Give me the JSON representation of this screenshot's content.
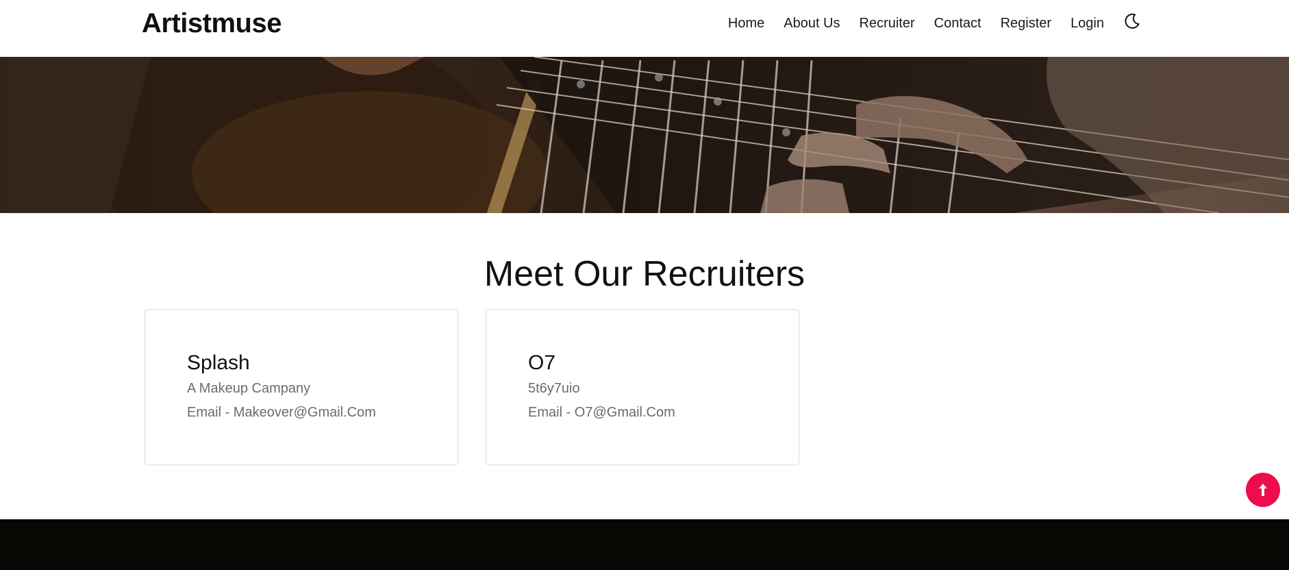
{
  "navbar": {
    "brand": "Artistmuse",
    "links": [
      "Home",
      "About Us",
      "Recruiter",
      "Contact",
      "Register",
      "Login"
    ],
    "theme_toggle_icon": "moon-icon"
  },
  "hero": {
    "image": "guitar-fretboard-photo"
  },
  "main": {
    "title": "Meet Our Recruiters",
    "recruiters": [
      {
        "name": "Splash",
        "description": "A Makeup Campany",
        "email": "Email - Makeover@Gmail.Com"
      },
      {
        "name": "O7",
        "description": "5t6y7uio",
        "email": "Email - O7@Gmail.Com"
      }
    ]
  },
  "scroll_top": {
    "icon": "arrow-up-icon",
    "color": "#ee0d4b"
  },
  "footer": {
    "color": "#080703"
  }
}
